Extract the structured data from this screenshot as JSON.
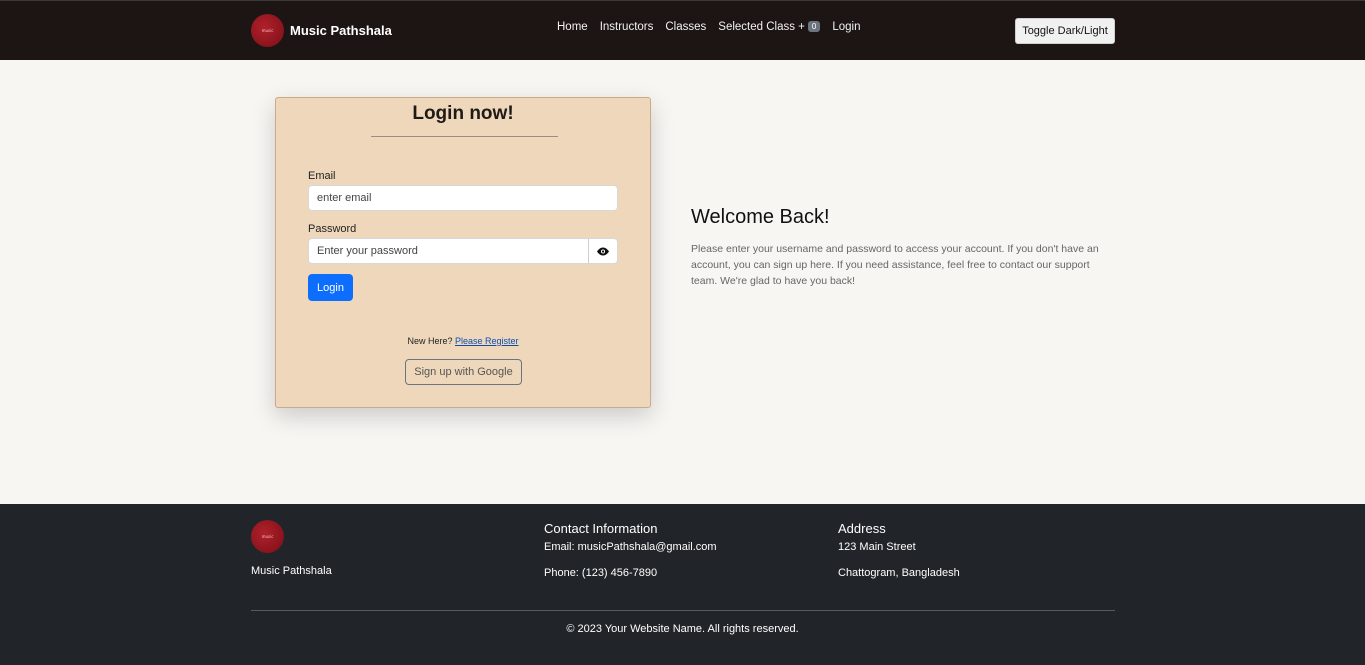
{
  "brand": {
    "name": "Music Pathshala",
    "logo_text": "music"
  },
  "nav": {
    "items": [
      "Home",
      "Instructors",
      "Classes",
      "Selected Class +",
      "Login"
    ],
    "selected_count": "0",
    "toggle_label": "Toggle Dark/Light"
  },
  "login": {
    "title": "Login now!",
    "email_label": "Email",
    "email_placeholder": "enter email",
    "password_label": "Password",
    "password_placeholder": "Enter your password",
    "submit_label": "Login",
    "new_here": "New Here?",
    "register_link": "Please Register",
    "google_label": "Sign up with Google"
  },
  "welcome": {
    "title": "Welcome Back!",
    "text": "Please enter your username and password to access your account. If you don't have an account, you can sign up here. If you need assistance, feel free to contact our support team. We're glad to have you back!"
  },
  "footer": {
    "brand": "Music Pathshala",
    "contact_heading": "Contact Information",
    "email": "Email: musicPathshala@gmail.com",
    "phone": "Phone: (123) 456-7890",
    "address_heading": "Address",
    "street": "123 Main Street",
    "city": "Chattogram, Bangladesh",
    "copyright": "© 2023 Your Website Name. All rights reserved."
  },
  "colors": {
    "navbar_bg": "#1c1514",
    "card_bg": "#efd7bb",
    "primary": "#0d6efd",
    "footer_bg": "#212529"
  },
  "icons": {
    "password_toggle": "eye-icon"
  }
}
